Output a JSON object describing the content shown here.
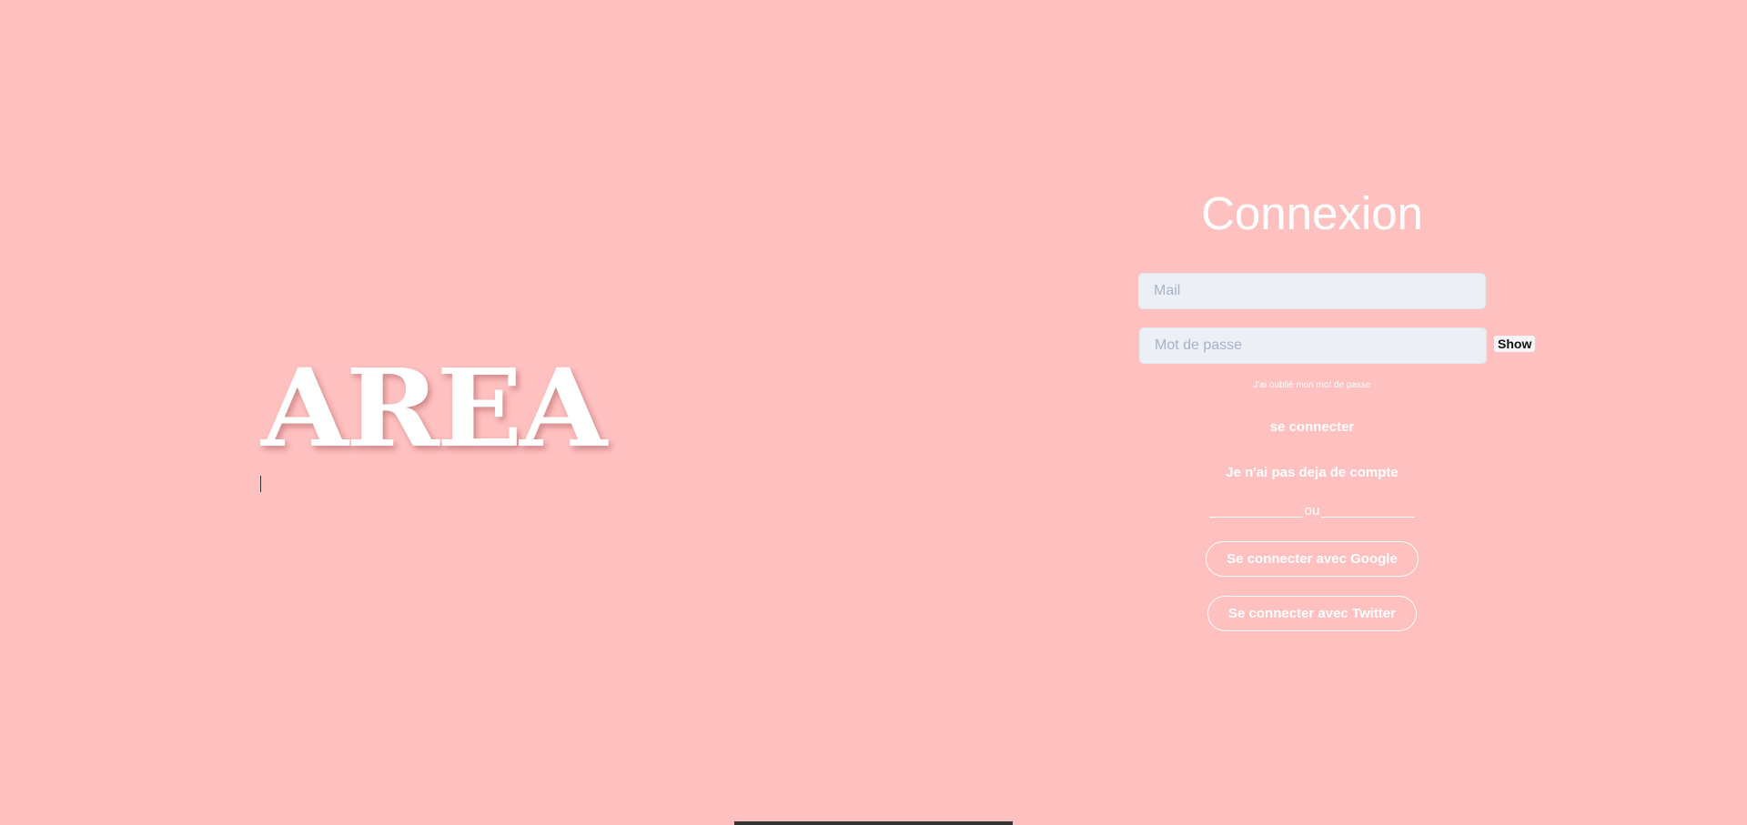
{
  "brand": {
    "logo_text": "AREA"
  },
  "login": {
    "title": "Connexion",
    "mail_placeholder": "Mail",
    "password_placeholder": "Mot de passe",
    "show_label": "Show",
    "forgot_label": "J'ai oublié mon mot de passe",
    "submit_label": "se connecter",
    "signup_label": "Je n'ai pas deja de compte",
    "separator_text": "ou",
    "google_label": "Se connecter avec Google",
    "twitter_label": "Se connecter avec Twitter"
  },
  "colors": {
    "background": "#ffc0c0",
    "text": "#ffffff",
    "input_bg": "#ecf0f6"
  }
}
